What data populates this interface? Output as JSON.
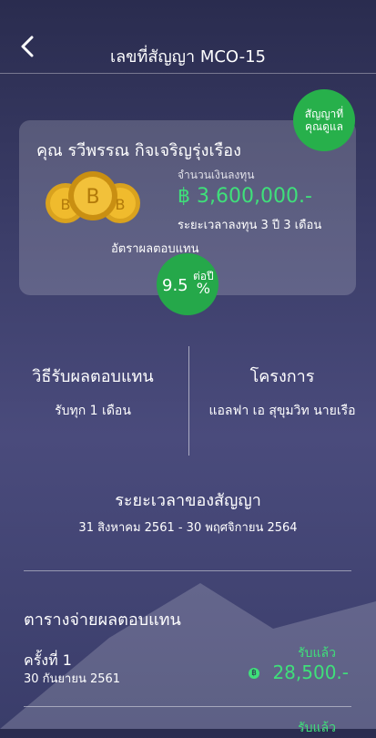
{
  "header": {
    "title": "เลขที่สัญญา MCO-15",
    "back_icon": "chevron-left-icon"
  },
  "card": {
    "badge_line1": "สัญญาที่",
    "badge_line2": "คุณดูแล",
    "name": "คุณ รวีพรรณ กิจเจริญรุ่งเรือง",
    "investment_label": "จำนวนเงินลงทุน",
    "amount": "฿ 3,600,000.-",
    "period": "ระยะเวลาลงทุน 3 ปี 3 เดือน",
    "rate_label": "อัตราผลตอบแทน",
    "rate_value": "9.5",
    "rate_unit_top": "ต่อปี",
    "rate_unit_bottom": "%"
  },
  "info": {
    "method_title": "วิธีรับผลตอบแทน",
    "method_value": "รับทุก 1 เดือน",
    "project_title": "โครงการ",
    "project_value": "แอลฟา เอ สุขุมวิท นายเรือ"
  },
  "contract": {
    "title": "ระยะเวลาของสัญญา",
    "range": "31 สิงหาคม 2561 - 30 พฤศจิกายน 2564"
  },
  "schedule": {
    "title": "ตารางจ่ายผลตอบแทน",
    "rows": [
      {
        "label": "ครั้งที่ 1",
        "date": "30 กันยายน 2561",
        "status": "รับแล้ว",
        "amount": "28,500.-"
      },
      {
        "label": "",
        "date": "",
        "status": "รับแล้ว",
        "amount": ""
      }
    ]
  },
  "colors": {
    "accent": "#3fe07a",
    "badge": "#27b04b",
    "background": "#3d3f6b"
  }
}
